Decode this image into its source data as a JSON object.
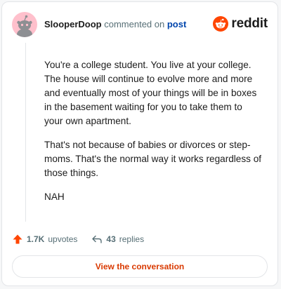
{
  "header": {
    "username": "SlooperDoop",
    "action_text": "commented on",
    "post_link_text": "post",
    "brand_name": "reddit"
  },
  "comment": {
    "paragraphs": [
      "You're a college student. You live at your college. The house will continue to evolve more and more and eventually most of your things will be in boxes in the basement waiting for you to take them to your own apartment.",
      "That's not because of babies or divorces or step-moms. That's the normal way it works regardless of those things.",
      "NAH"
    ]
  },
  "footer": {
    "upvotes_count": "1.7K",
    "upvotes_label": "upvotes",
    "replies_count": "43",
    "replies_label": "replies"
  },
  "cta": {
    "label": "View the conversation"
  },
  "icons": {
    "avatar": "snoo-avatar-icon",
    "brand": "reddit-logo-icon",
    "upvote": "upvote-arrow-icon",
    "reply": "reply-arrow-icon"
  },
  "colors": {
    "brand_orange": "#ff4500",
    "upvote_orange": "#ff4500",
    "link_blue": "#0045ac",
    "cta_text": "#d93900",
    "avatar_bg": "#ffc0cc"
  }
}
